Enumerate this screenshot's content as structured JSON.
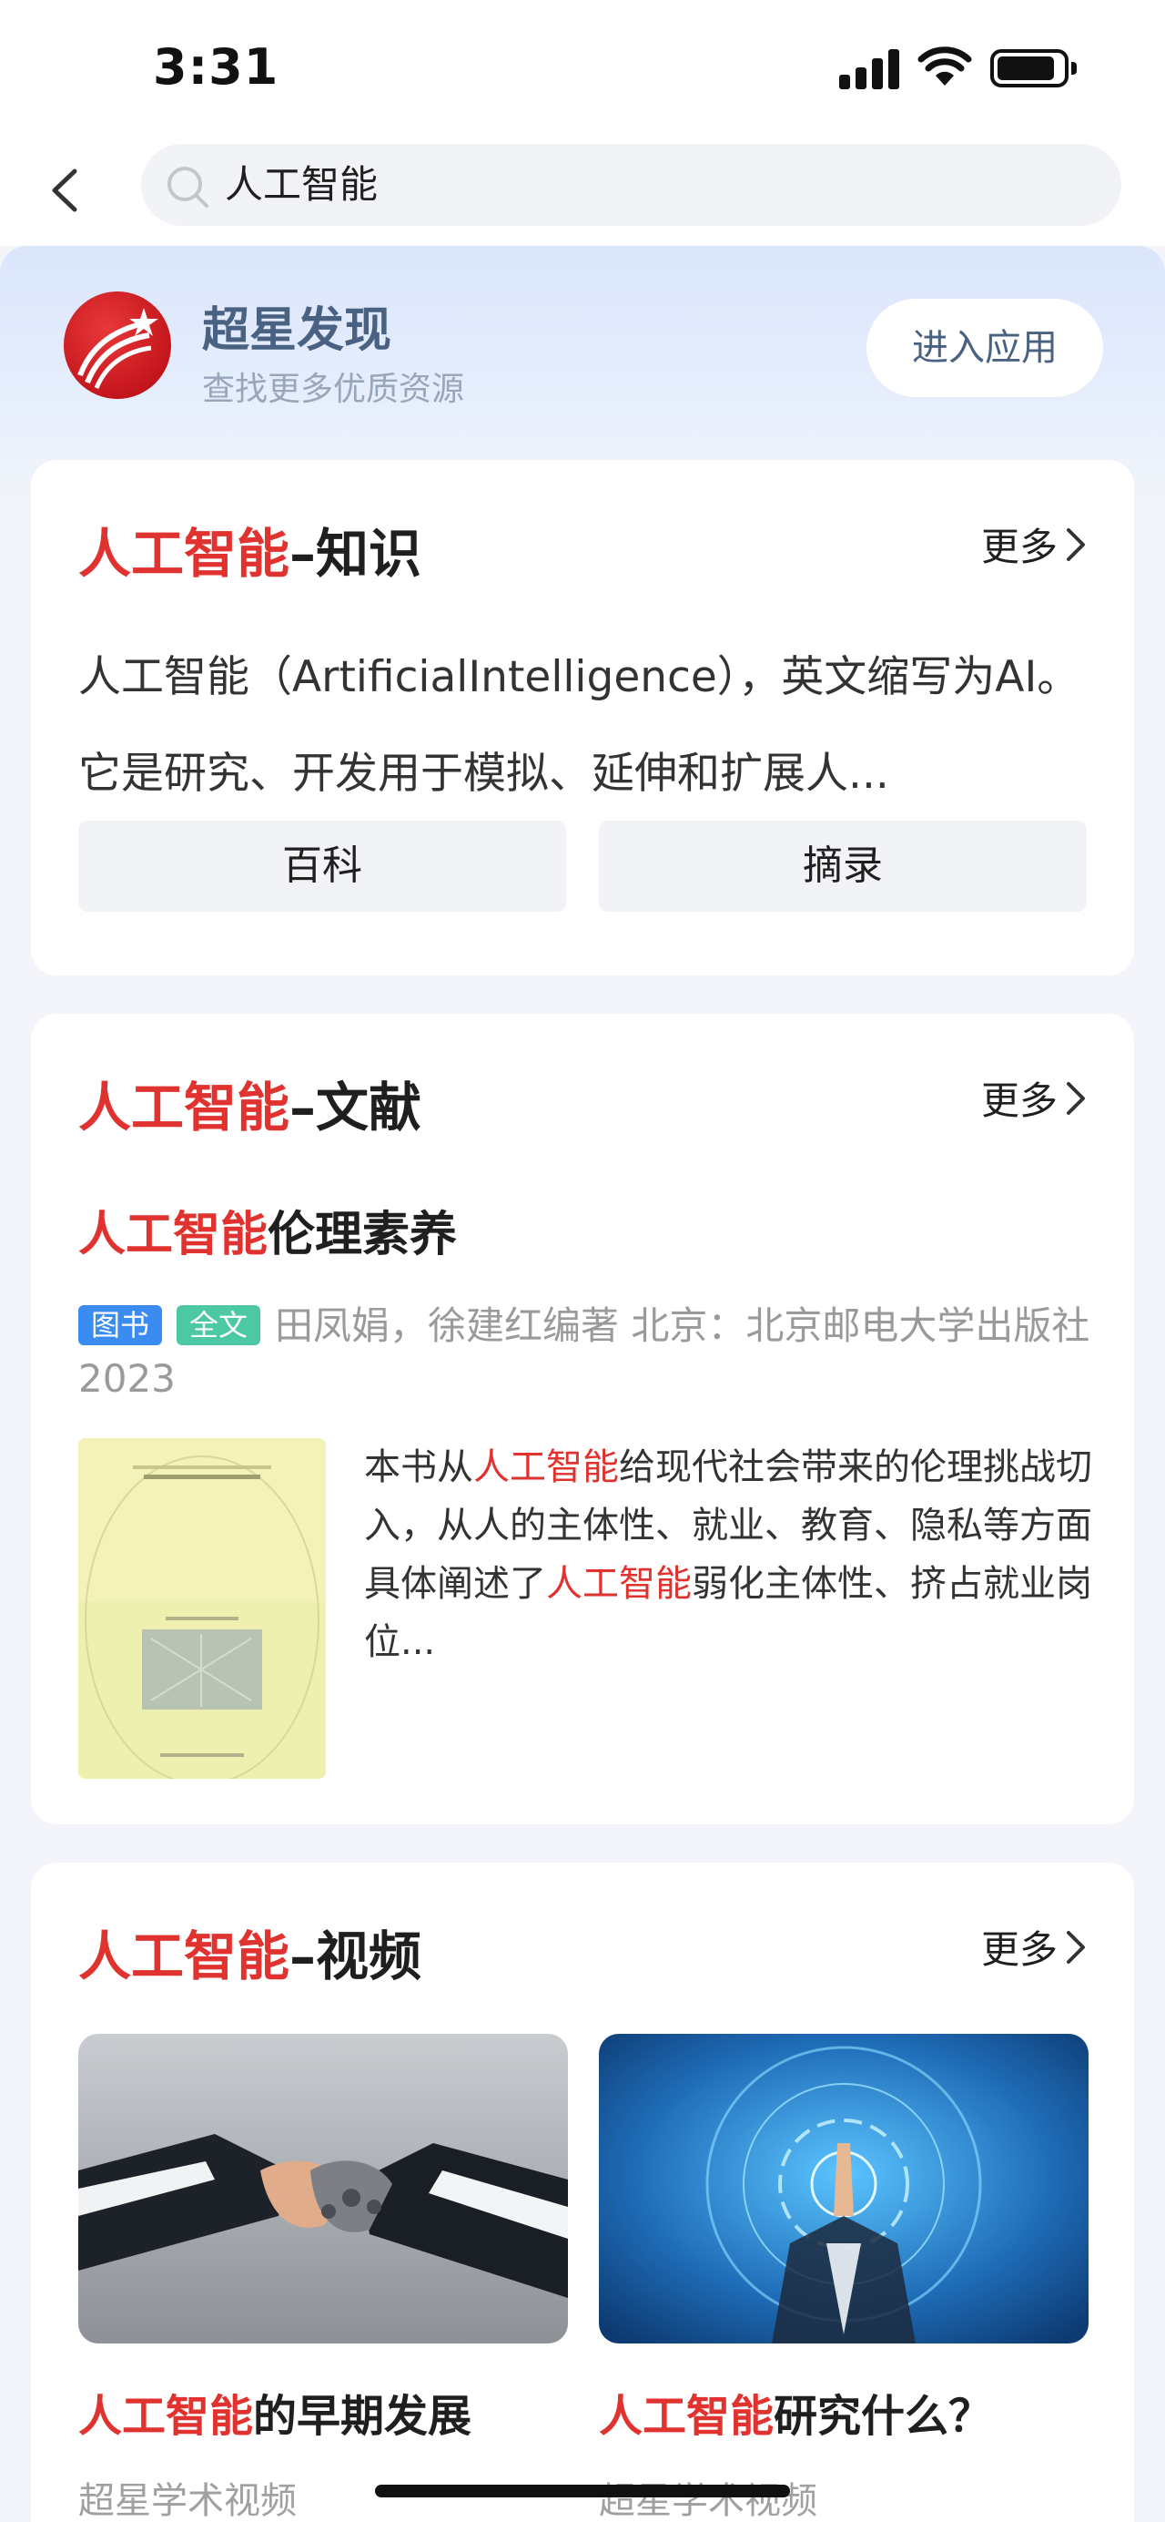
{
  "status_bar": {
    "time": "3:31"
  },
  "search": {
    "query": "人工智能"
  },
  "banner": {
    "title": "超星发现",
    "subtitle": "查找更多优质资源",
    "enter_button": "进入应用"
  },
  "colors": {
    "highlight": "#e0322f",
    "banner_text": "#4a6282",
    "tag_book": "#3b8cf0",
    "tag_fulltext": "#4dc8a4"
  },
  "knowledge": {
    "keyword": "人工智能",
    "suffix": "–知识",
    "more": "更多",
    "text": "人工智能（ArtificialIntelligence），英文缩写为AI。它是研究、开发用于模拟、延伸和扩展人...",
    "buttons": [
      "百科",
      "摘录"
    ]
  },
  "literature": {
    "keyword": "人工智能",
    "suffix": "–文献",
    "more": "更多",
    "book": {
      "title_keyword": "人工智能",
      "title_rest": "伦理素养",
      "tags": [
        "图书",
        "全文"
      ],
      "meta": "田凤娟，徐建红编著  北京：北京邮电大学出版社  2023",
      "desc_1": "本书从",
      "desc_kw1": "人工智能",
      "desc_2": "给现代社会带来的伦理挑战切入，从人的主体性、就业、教育、隐私等方面具体阐述了",
      "desc_kw2": "人工智能",
      "desc_3": "弱化主体性、挤占就业岗位..."
    }
  },
  "video": {
    "keyword": "人工智能",
    "suffix": "–视频",
    "more": "更多",
    "items": [
      {
        "keyword": "人工智能",
        "rest": "的早期发展",
        "source": "超星学术视频",
        "icon": "handshake-thumbnail"
      },
      {
        "keyword": "人工智能",
        "rest": "研究什么？",
        "source": "超星学术视频",
        "icon": "touch-screen-thumbnail"
      }
    ]
  }
}
